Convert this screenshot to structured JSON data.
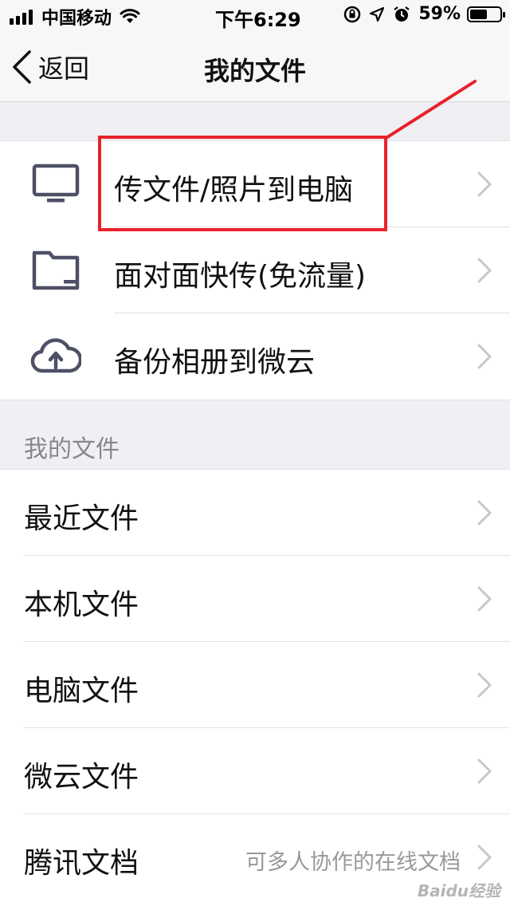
{
  "status_bar": {
    "carrier": "中国移动",
    "time": "下午6:29",
    "battery_percent": "59%",
    "battery_level": 0.59,
    "icons": [
      "signal-icon",
      "wifi-icon",
      "orientation-lock-icon",
      "location-icon",
      "alarm-icon",
      "battery-icon"
    ]
  },
  "nav": {
    "back_label": "返回",
    "title": "我的文件"
  },
  "transfer_group": {
    "items": [
      {
        "label": "传文件/照片到电脑",
        "icon": "monitor-icon"
      },
      {
        "label": "面对面快传(免流量)",
        "icon": "folder-icon"
      },
      {
        "label": "备份相册到微云",
        "icon": "cloud-upload-icon"
      }
    ]
  },
  "files_section": {
    "header": "我的文件",
    "items": [
      {
        "label": "最近文件",
        "subtext": ""
      },
      {
        "label": "本机文件",
        "subtext": ""
      },
      {
        "label": "电脑文件",
        "subtext": ""
      },
      {
        "label": "微云文件",
        "subtext": ""
      },
      {
        "label": "腾讯文档",
        "subtext": "可多人协作的在线文档"
      }
    ]
  },
  "annotation": {
    "color": "#e8212b"
  },
  "watermark": "Baidu经验"
}
